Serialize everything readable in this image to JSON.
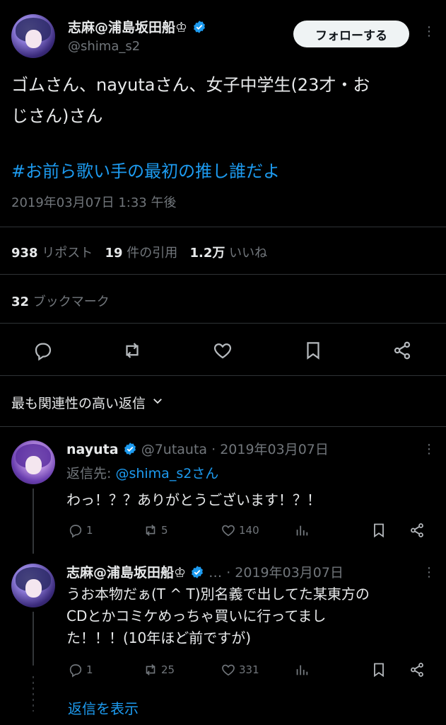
{
  "tweet": {
    "author_name": "志麻@浦島坂田船♔",
    "author_handle": "@shima_s2",
    "follow_label": "フォローする",
    "more_label": "⋮",
    "text_line1": "ゴムさん、nayutaさん、女子中学生(23才・お",
    "text_line2": "じさん)さん",
    "hashtag": "#お前ら歌い手の最初の推し誰だよ",
    "timestamp": "2019年03月07日 1:33 午後",
    "reposts_count": "938",
    "reposts_label": "リポスト",
    "quotes_count": "19",
    "quotes_label": "件の引用",
    "likes_count": "1.2万",
    "likes_label": "いいね",
    "bookmarks_count": "32",
    "bookmarks_label": "ブックマーク"
  },
  "sort": {
    "label": "最も関連性の高い返信"
  },
  "replies": [
    {
      "name": "nayuta",
      "handle": "@7utauta",
      "sep": "·",
      "date": "2019年03月07日",
      "reply_to_prefix": "返信先: ",
      "reply_to_handle": "@shima_s2さん",
      "text": "わっ！？？ありがとうございます！？！",
      "replies": "1",
      "reposts": "5",
      "likes": "140"
    },
    {
      "name": "志麻@浦島坂田船♔",
      "ellipsis": "…",
      "sep": "·",
      "date": "2019年03月07日",
      "text_line1": "うお本物だぁ(T ^ T)別名義で出してた某東方の",
      "text_line2": "CDとかコミケめっちゃ買いに行ってまし",
      "text_line3": "た！！！(10年ほど前ですが)",
      "replies": "1",
      "reposts": "25",
      "likes": "331"
    }
  ],
  "show_replies_label": "返信を表示",
  "colors": {
    "accent": "#1d9bf0",
    "muted": "#71767b",
    "background": "#000000",
    "text": "#e7e9ea"
  }
}
